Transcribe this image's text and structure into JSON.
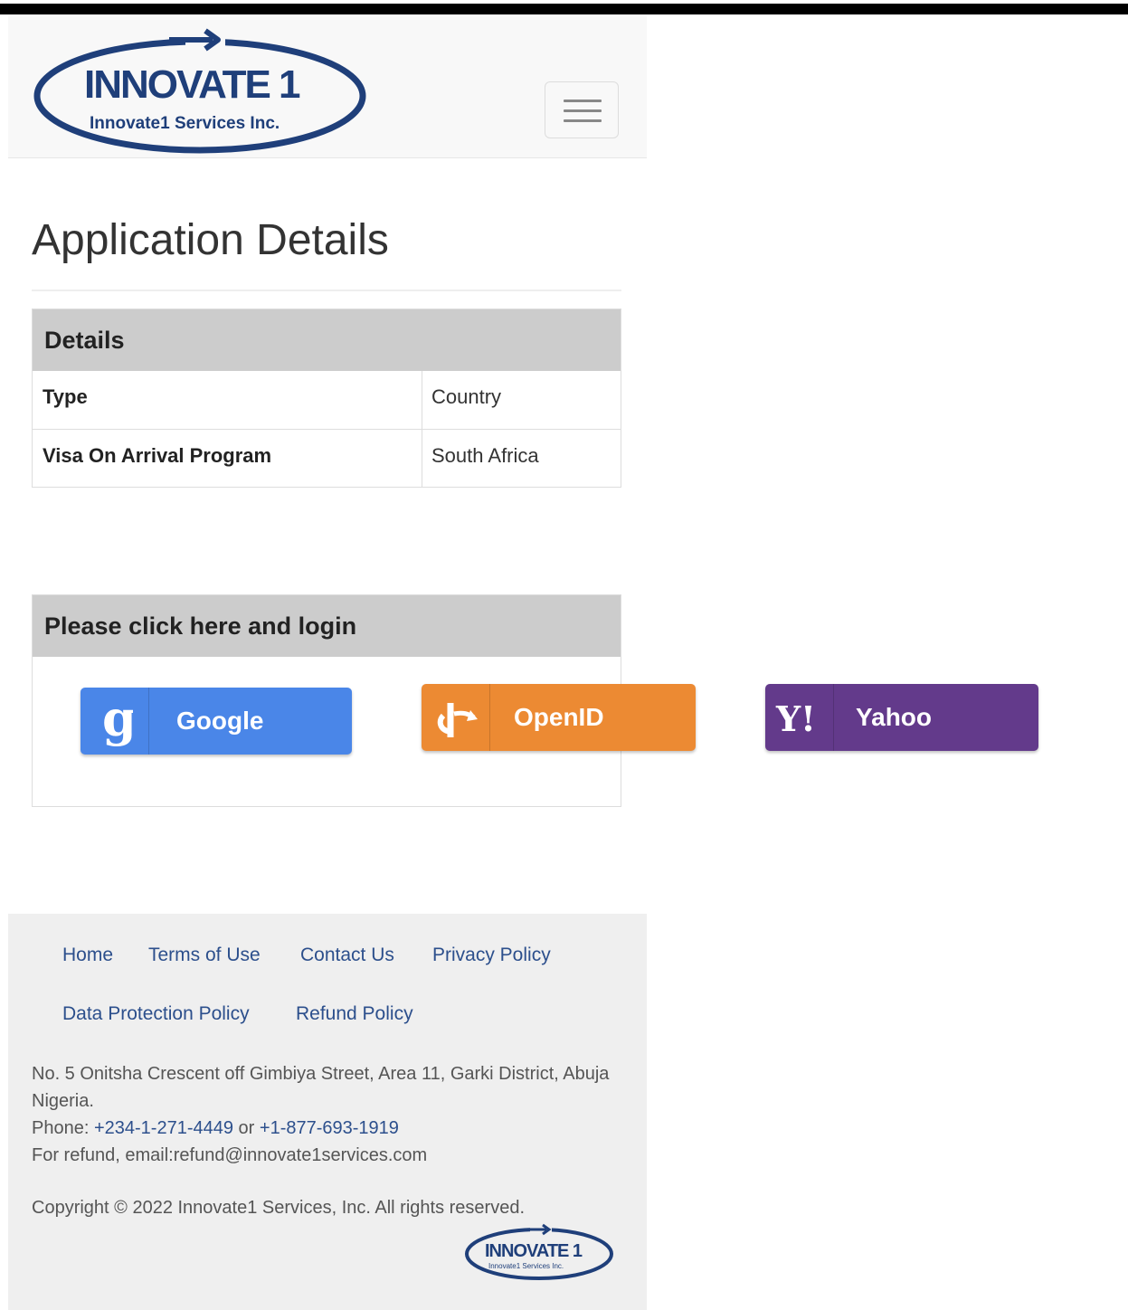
{
  "brand": {
    "logo_word": "INNOVATE 1",
    "logo_sub": "Innovate1 Services Inc."
  },
  "page": {
    "title": "Application Details"
  },
  "details": {
    "heading": "Details",
    "rows": [
      {
        "label": "Type",
        "value": "Country"
      },
      {
        "label": "Visa On Arrival Program",
        "value": "South Africa"
      }
    ]
  },
  "login": {
    "heading": "Please click here and login",
    "buttons": [
      {
        "label": "Google",
        "icon": "google-icon",
        "color": "#4a86e8"
      },
      {
        "label": "OpenID",
        "icon": "openid-icon",
        "color": "#ec8a33"
      },
      {
        "label": "Yahoo",
        "icon": "yahoo-icon",
        "color": "#633a8b"
      }
    ]
  },
  "footer": {
    "links": [
      "Home",
      "Terms of Use",
      "Contact Us",
      "Privacy Policy",
      "Data Protection Policy",
      "Refund Policy"
    ],
    "address": "No. 5 Onitsha Crescent off Gimbiya Street, Area 11, Garki District, Abuja Nigeria.",
    "phone_label": "Phone:",
    "phone1": "+234-1-271-4449",
    "phone_or": "or",
    "phone2": "+1-877-693-1919",
    "refund": "For refund, email:refund@innovate1services.com",
    "copyright": "Copyright © 2022 Innovate1 Services, Inc. All rights reserved."
  },
  "colors": {
    "link": "#2c4f8c",
    "logo_blue": "#1f3f7a",
    "panel_heading": "#cccccc"
  }
}
